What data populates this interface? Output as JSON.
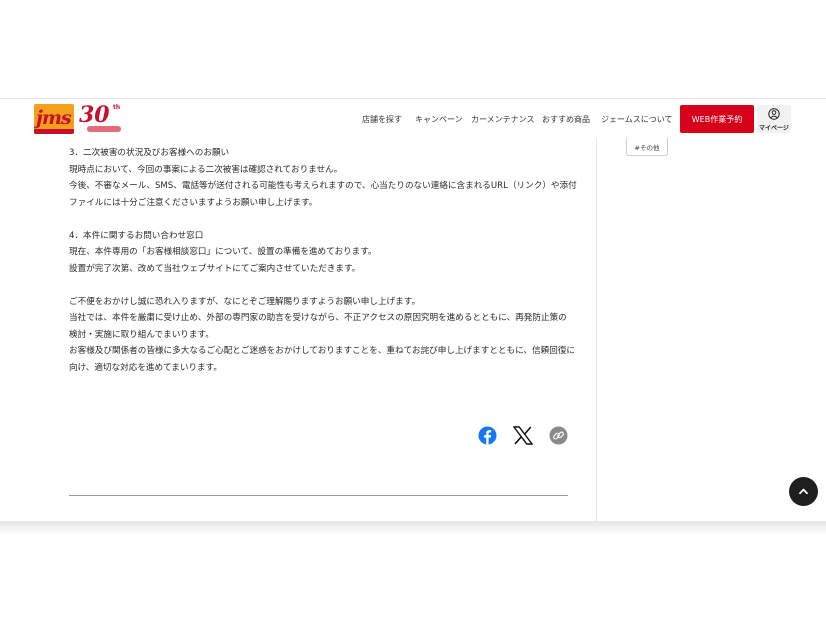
{
  "header": {
    "logo_text": "jms",
    "anniversary_text": "30",
    "anniversary_suffix": "th",
    "nav": [
      "店舗を探す",
      "キャンペーン",
      "カーメンテナンス",
      "おすすめ商品",
      "ジェームスについて"
    ],
    "reserve_label": "WEB作業予約",
    "mypage_label": "マイページ",
    "accent_color": "#d7001a"
  },
  "sidebar": {
    "tag": "#その他"
  },
  "article": {
    "lines": [
      "3．二次被害の状況及びお客様へのお願い",
      "現時点において、今回の事案による二次被害は確認されておりません。",
      "今後、不審なメール、SMS、電話等が送付される可能性も考えられますので、心当たりのない連絡に含まれるURL（リンク）や添付",
      "ファイルには十分ご注意くださいますようお願い申し上げます。",
      "",
      "4．本件に関するお問い合わせ窓口",
      "現在、本件専用の「お客様相談窓口」について、設置の準備を進めております。",
      "設置が完了次第、改めて当社ウェブサイトにてご案内させていただきます。",
      "",
      "ご不便をおかけし誠に恐れ入りますが、なにとぞご理解賜りますようお願い申し上げます。",
      "当社では、本件を厳粛に受け止め、外部の専門家の助言を受けながら、不正アクセスの原因究明を進めるとともに、再発防止策の",
      "検討・実施に取り組んでまいります。",
      "お客様及び関係者の皆様に多大なるご心配とご迷惑をおかけしておりますことを、重ねてお詫び申し上げますとともに、信頼回復に",
      "向け、適切な対応を進めてまいります。"
    ]
  },
  "share": {
    "icons": [
      "facebook-icon",
      "x-icon",
      "link-icon"
    ]
  }
}
